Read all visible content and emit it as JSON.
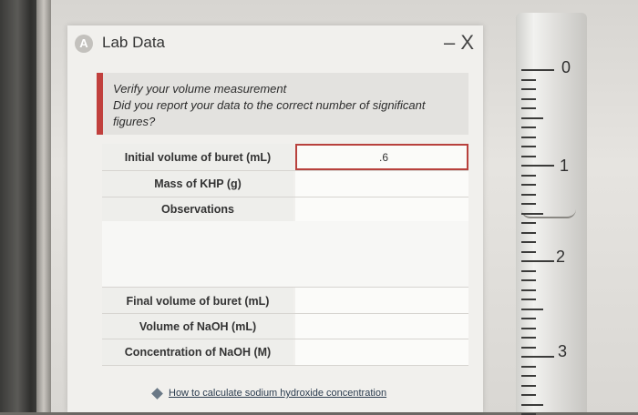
{
  "panel": {
    "title": "Lab Data",
    "icon_letter": "A",
    "window_controls": "– X"
  },
  "feedback": {
    "line1": "Verify your volume measurement",
    "line2": "Did you report your data to the correct number of significant figures?"
  },
  "table": {
    "rows": [
      {
        "label": "Initial volume of buret (mL)",
        "value": ".6",
        "error": true
      },
      {
        "label": "Mass of KHP (g)",
        "value": ""
      },
      {
        "label": "Observations",
        "value": ""
      },
      {
        "label": "Final volume of buret (mL)",
        "value": ""
      },
      {
        "label": "Volume of NaOH (mL)",
        "value": ""
      },
      {
        "label": "Concentration of NaOH (M)",
        "value": ""
      }
    ]
  },
  "help_link": "How to calculate sodium hydroxide concentration",
  "buret": {
    "labels": [
      "0",
      "1",
      "2",
      "3"
    ]
  },
  "colors": {
    "error": "#c1403d",
    "link": "#2b3c4f"
  }
}
